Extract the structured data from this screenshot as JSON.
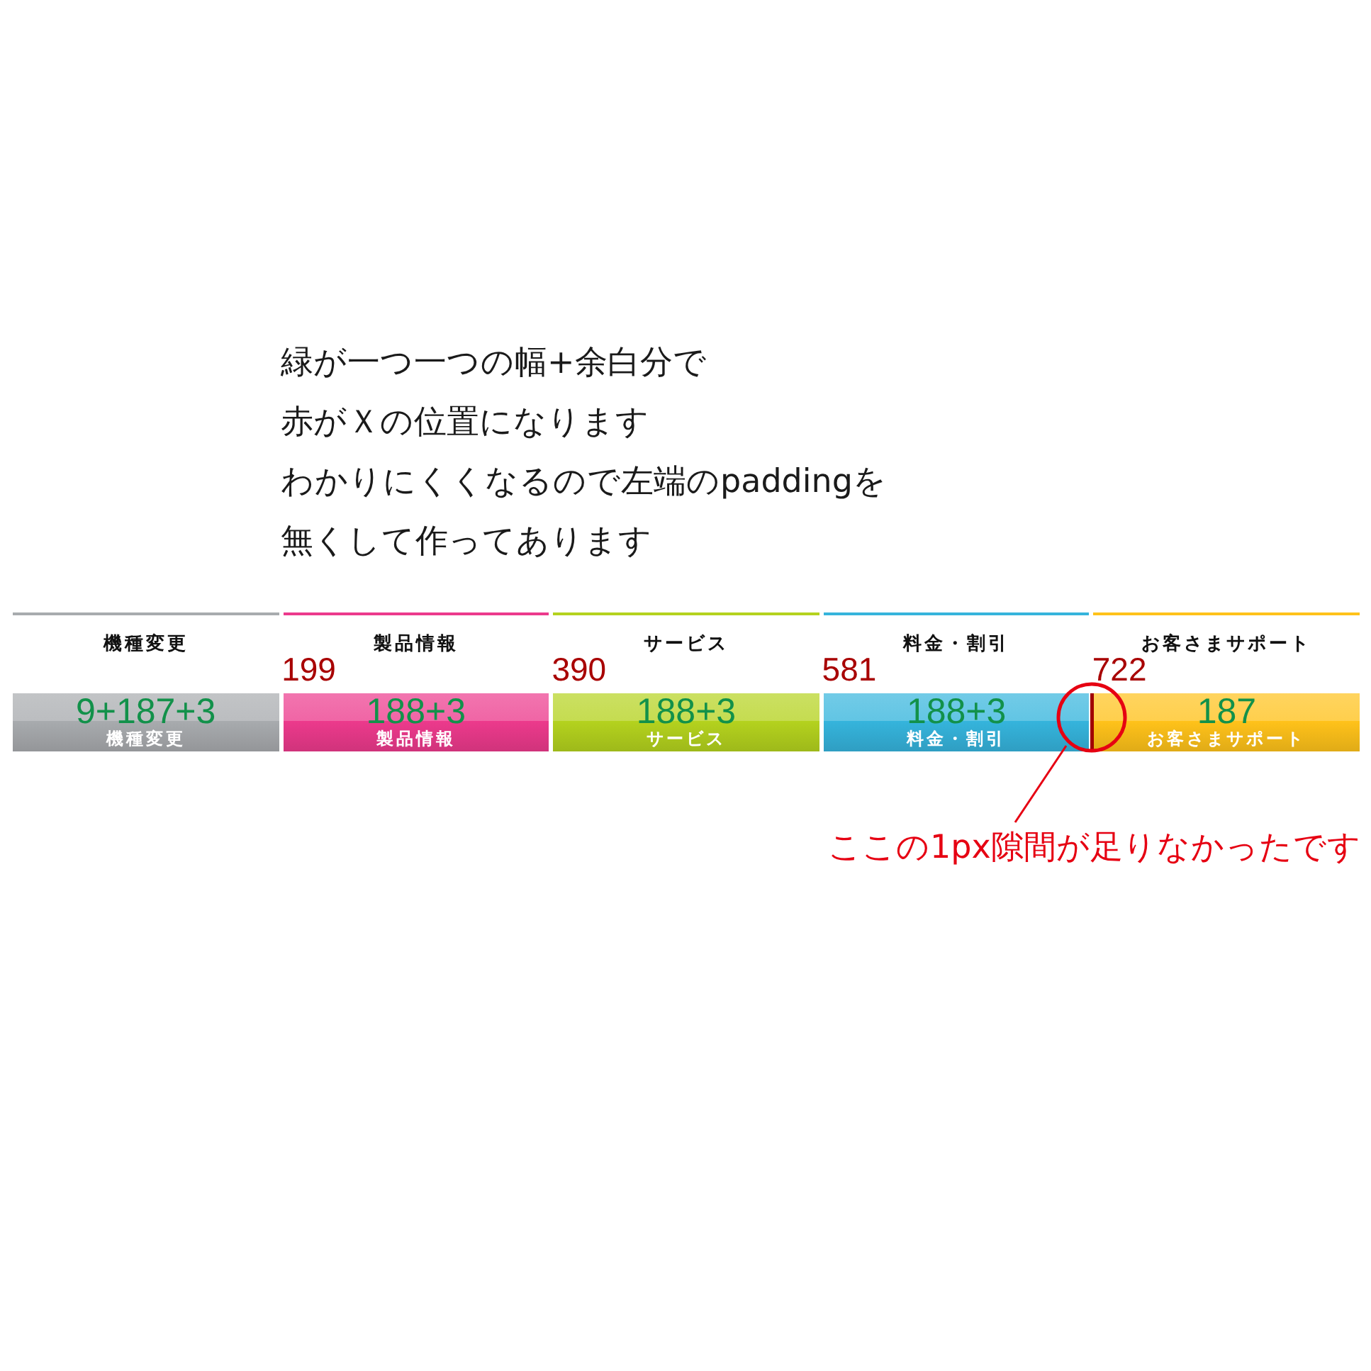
{
  "note": {
    "lines": [
      "緑が一つ一つの幅+余白分で",
      "赤がＸの位置になります",
      "わかりにくくなるので左端のpaddingを",
      "無くして作ってあります"
    ]
  },
  "nav": {
    "items": [
      {
        "heading": "機種変更",
        "button": "機種変更",
        "color": "#a8abae",
        "width_note": "9+187+3"
      },
      {
        "heading": "製品情報",
        "button": "製品情報",
        "color": "#ec3a8c",
        "x_note": "199",
        "width_note": "188+3"
      },
      {
        "heading": "サービス",
        "button": "サービス",
        "color": "#b4d21e",
        "x_note": "390",
        "width_note": "188+3"
      },
      {
        "heading": "料金・割引",
        "button": "料金・割引",
        "color": "#35b4dc",
        "x_note": "581",
        "width_note": "188+3"
      },
      {
        "heading": "お客さまサポート",
        "button": "お客さまサポート",
        "color": "#ffc21a",
        "x_note": "722",
        "width_note": "187"
      }
    ]
  },
  "callout": {
    "text": "ここの1px隙間が足りなかったです"
  }
}
